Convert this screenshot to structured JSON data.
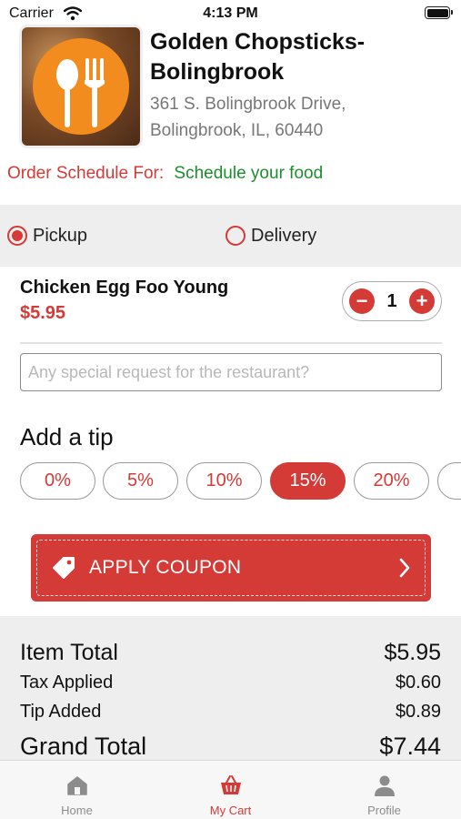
{
  "status_bar": {
    "carrier": "Carrier",
    "time": "4:13 PM"
  },
  "restaurant": {
    "name": "Golden Chopsticks- Bolingbrook",
    "address": "361 S. Bolingbrook Drive, Bolingbrook, IL, 60440"
  },
  "schedule": {
    "label": "Order Schedule For:",
    "value": "Schedule your food"
  },
  "order_type": {
    "options": [
      {
        "label": "Pickup",
        "selected": true
      },
      {
        "label": "Delivery",
        "selected": false
      }
    ]
  },
  "cart_item": {
    "name": "Chicken Egg Foo Young",
    "price": "$5.95",
    "quantity": "1",
    "minus": "−",
    "plus": "+"
  },
  "special_request": {
    "placeholder": "Any special request for the restaurant?"
  },
  "tip": {
    "title": "Add a tip",
    "options": [
      "0%",
      "5%",
      "10%",
      "15%",
      "20%"
    ],
    "selected": "15%"
  },
  "coupon": {
    "label": "APPLY COUPON",
    "icon": "tag-icon"
  },
  "totals": {
    "item_total_label": "Item Total",
    "item_total": "$5.95",
    "tax_label": "Tax Applied",
    "tax": "$0.60",
    "tip_label": "Tip Added",
    "tip": "$0.89",
    "grand_total_label": "Grand Total",
    "grand_total": "$7.44"
  },
  "tabbar": {
    "items": [
      {
        "label": "Home",
        "icon": "home-icon",
        "active": false
      },
      {
        "label": "My Cart",
        "icon": "basket-icon",
        "active": true
      },
      {
        "label": "Profile",
        "icon": "person-icon",
        "active": false
      }
    ]
  },
  "colors": {
    "accent": "#d43a36",
    "success": "#1b8f2a",
    "logo_orange": "#f28c1e"
  }
}
